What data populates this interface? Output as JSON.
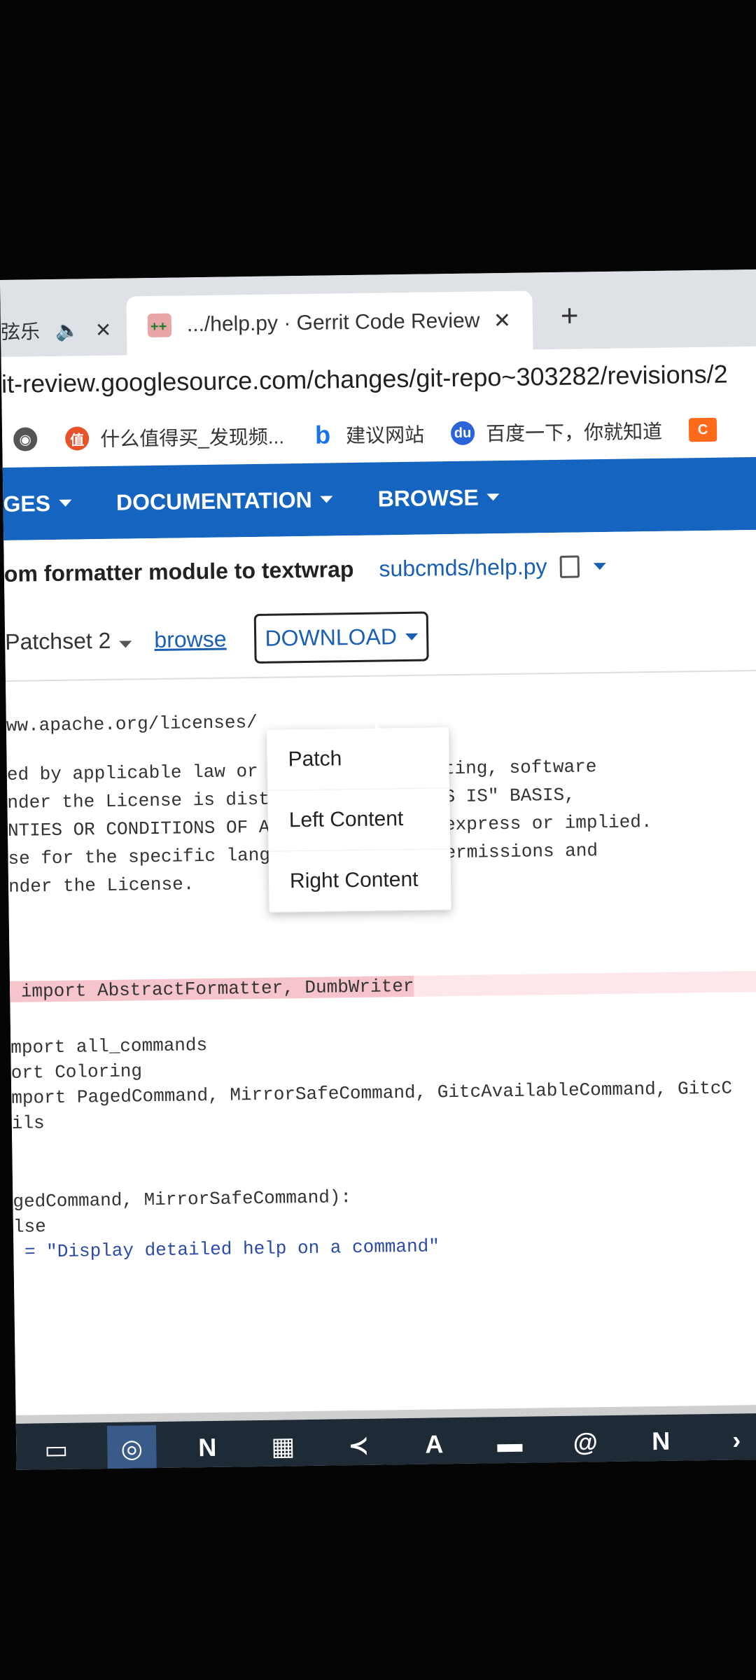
{
  "browser": {
    "tabs": [
      {
        "title": "弦乐",
        "active": false
      },
      {
        "title": ".../help.py · Gerrit Code Review",
        "active": true
      }
    ],
    "new_tab_label": "+",
    "address": "it-review.googlesource.com/changes/git-repo~303282/revisions/2",
    "bookmarks": [
      {
        "label": "",
        "icon": "globe-icon"
      },
      {
        "label": "什么值得买_发现频...",
        "icon": "zhi-icon"
      },
      {
        "label": "建议网站",
        "icon": "bing-icon"
      },
      {
        "label": "百度一下，你就知道",
        "icon": "baidu-paw-icon"
      },
      {
        "label": "C",
        "icon": "orange-c-icon"
      }
    ]
  },
  "gerrit": {
    "nav": [
      "GES",
      "DOCUMENTATION",
      "BROWSE"
    ],
    "subject": "om formatter module to textwrap",
    "file_path": "subcmds/help.py",
    "patchset_label": "Patchset 2",
    "browse_label": "browse",
    "download_label": "DOWNLOAD",
    "download_menu": [
      "Patch",
      "Left Content",
      "Right Content"
    ],
    "code_lines": [
      "ww.apache.org/licenses/",
      "ed by applicable law or agreed to in writing, software",
      "nder the License is distributed on an \"AS IS\" BASIS,",
      "NTIES OR CONDITIONS OF ANY KIND, either express or implied.",
      "se for the specific language governing permissions and",
      "nder the License.",
      " import AbstractFormatter, DumbWriter",
      "mport all_commands",
      "ort Coloring",
      "mport PagedCommand, MirrorSafeCommand, GitcAvailableCommand, GitcC",
      "ils",
      "gedCommand, MirrorSafeCommand):",
      "lse",
      " = \"Display detailed help on a command\""
    ]
  },
  "taskbar": [
    "windows-device-icon",
    "chrome-icon",
    "notion-icon",
    "calculator-icon",
    "vscode-icon",
    "acrobat-icon",
    "file-explorer-icon",
    "snail-app-icon",
    "notion-icon-2",
    "more-icon"
  ]
}
